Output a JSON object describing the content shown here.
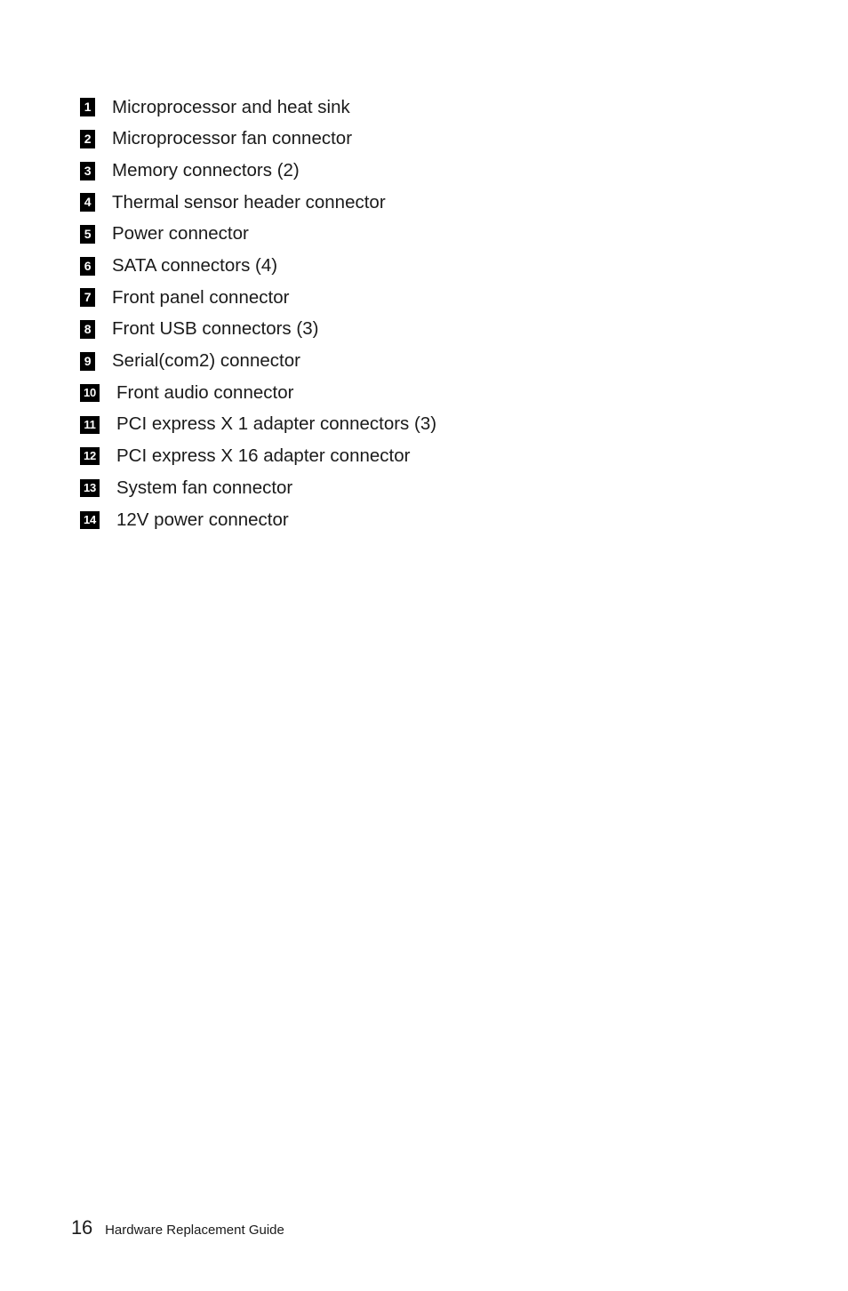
{
  "document": {
    "page_number": "16",
    "guide_title": "Hardware Replacement Guide"
  },
  "legend": {
    "items": [
      {
        "number": "1",
        "label": "Microprocessor and heat sink"
      },
      {
        "number": "2",
        "label": "Microprocessor fan connector"
      },
      {
        "number": "3",
        "label": "Memory connectors (2)"
      },
      {
        "number": "4",
        "label": "Thermal sensor header connector"
      },
      {
        "number": "5",
        "label": "Power connector"
      },
      {
        "number": "6",
        "label": "SATA connectors (4)"
      },
      {
        "number": "7",
        "label": "Front panel connector"
      },
      {
        "number": "8",
        "label": "Front USB connectors (3)"
      },
      {
        "number": "9",
        "label": "Serial(com2) connector"
      },
      {
        "number": "10",
        "label": "Front audio connector"
      },
      {
        "number": "11",
        "label": "PCI express X 1 adapter connectors (3)"
      },
      {
        "number": "12",
        "label": "PCI express X 16 adapter connector"
      },
      {
        "number": "13",
        "label": "System fan connector"
      },
      {
        "number": "14",
        "label": "12V power connector"
      }
    ]
  },
  "colors": {
    "page_background": "#ffffff",
    "text": "#1a1a1a",
    "badge_background": "#000000",
    "badge_text": "#ffffff"
  }
}
